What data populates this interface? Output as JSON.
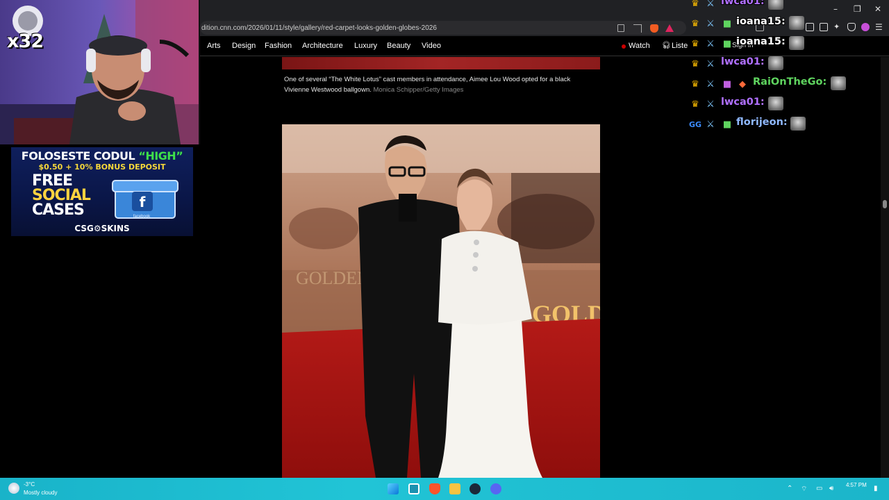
{
  "browser": {
    "url": "dition.cnn.com/2026/01/11/style/gallery/red-carpet-looks-golden-globes-2026",
    "window_controls": [
      "–",
      "❐",
      "✕"
    ]
  },
  "nav": {
    "items": [
      "Arts",
      "Design",
      "Fashion",
      "Architecture",
      "Luxury",
      "Beauty",
      "Video"
    ],
    "watch": "Watch",
    "listen": "Liste",
    "sign_in": "Sign in"
  },
  "article": {
    "caption": "One of several “The White Lotus” cast members in attendance, Aimee Lou Wood opted for a black Vivienne Westwood ballgown.",
    "credit": "Monica Schipper/Getty Images",
    "photo_sign_left": "GOLDEN",
    "photo_sign_right": "GOLDE"
  },
  "overlay": {
    "sub_count": "x32",
    "promo": {
      "line1_prefix": "FOLOSESTE CODUL ",
      "line1_code": "“HIGH”",
      "line2": "$0.50 + 10% BONUS DEPOSIT",
      "free": "FREE",
      "social": "SOCIAL",
      "cases": "CASES",
      "brand": "CSG⚙SKINS",
      "facebook": "facebook"
    }
  },
  "chat": {
    "messages": [
      {
        "user": "lwca01:",
        "color": "#b070ff"
      },
      {
        "user": "ioana15:",
        "color": "#ffffff"
      },
      {
        "user": "ioana15:",
        "color": "#ffffff"
      },
      {
        "user": "lwca01:",
        "color": "#b070ff"
      },
      {
        "user": "RaiOnTheGo:",
        "color": "#5fd45f"
      },
      {
        "user": "lwca01:",
        "color": "#b070ff"
      },
      {
        "user": "florijeon:",
        "color": "#8fb8ff"
      }
    ]
  },
  "taskbar": {
    "weather_temp": "-3°C",
    "weather_desc": "Mostly cloudy",
    "time": "4:57 PM"
  }
}
